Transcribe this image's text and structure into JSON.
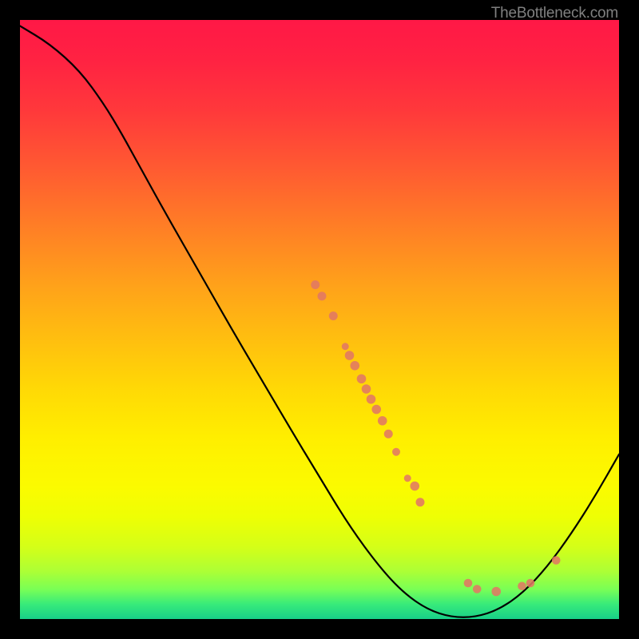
{
  "attribution": "TheBottleneck.com",
  "chart_data": {
    "type": "line",
    "title": "",
    "xlabel": "",
    "ylabel": "",
    "xlim": [
      0,
      100
    ],
    "ylim": [
      0,
      100
    ],
    "gradient_stops": [
      {
        "offset": 0.0,
        "color": "#ff1846"
      },
      {
        "offset": 0.07,
        "color": "#ff2342"
      },
      {
        "offset": 0.15,
        "color": "#ff383b"
      },
      {
        "offset": 0.25,
        "color": "#ff5b31"
      },
      {
        "offset": 0.35,
        "color": "#ff8025"
      },
      {
        "offset": 0.45,
        "color": "#ffa419"
      },
      {
        "offset": 0.55,
        "color": "#ffc40d"
      },
      {
        "offset": 0.62,
        "color": "#ffda05"
      },
      {
        "offset": 0.7,
        "color": "#ffef00"
      },
      {
        "offset": 0.78,
        "color": "#fbfb00"
      },
      {
        "offset": 0.83,
        "color": "#eeff04"
      },
      {
        "offset": 0.88,
        "color": "#d4ff18"
      },
      {
        "offset": 0.92,
        "color": "#adff35"
      },
      {
        "offset": 0.95,
        "color": "#7aff55"
      },
      {
        "offset": 0.975,
        "color": "#38eb7a"
      },
      {
        "offset": 1.0,
        "color": "#18cf88"
      }
    ],
    "curve": [
      {
        "x": 0.0,
        "y": 99.0
      },
      {
        "x": 5.0,
        "y": 96.0
      },
      {
        "x": 10.0,
        "y": 91.5
      },
      {
        "x": 14.0,
        "y": 86.0
      },
      {
        "x": 17.0,
        "y": 81.0
      },
      {
        "x": 20.0,
        "y": 75.5
      },
      {
        "x": 25.0,
        "y": 66.5
      },
      {
        "x": 30.0,
        "y": 57.8
      },
      {
        "x": 35.0,
        "y": 49.0
      },
      {
        "x": 40.0,
        "y": 40.5
      },
      {
        "x": 45.0,
        "y": 32.0
      },
      {
        "x": 50.0,
        "y": 23.7
      },
      {
        "x": 55.0,
        "y": 15.5
      },
      {
        "x": 60.0,
        "y": 8.7
      },
      {
        "x": 64.0,
        "y": 4.4
      },
      {
        "x": 68.0,
        "y": 1.6
      },
      {
        "x": 72.0,
        "y": 0.3
      },
      {
        "x": 76.0,
        "y": 0.3
      },
      {
        "x": 80.0,
        "y": 1.6
      },
      {
        "x": 84.0,
        "y": 4.4
      },
      {
        "x": 88.0,
        "y": 8.7
      },
      {
        "x": 92.0,
        "y": 14.2
      },
      {
        "x": 96.0,
        "y": 20.5
      },
      {
        "x": 100.0,
        "y": 27.5
      }
    ],
    "dots": [
      {
        "x": 49.3,
        "y": 55.8,
        "r": 5.5
      },
      {
        "x": 50.4,
        "y": 53.9,
        "r": 5.5
      },
      {
        "x": 52.3,
        "y": 50.6,
        "r": 5.5
      },
      {
        "x": 54.3,
        "y": 45.5,
        "r": 4.5
      },
      {
        "x": 55.0,
        "y": 44.0,
        "r": 5.8
      },
      {
        "x": 55.9,
        "y": 42.3,
        "r": 5.8
      },
      {
        "x": 57.0,
        "y": 40.1,
        "r": 5.8
      },
      {
        "x": 57.8,
        "y": 38.4,
        "r": 5.8
      },
      {
        "x": 58.6,
        "y": 36.7,
        "r": 5.8
      },
      {
        "x": 59.5,
        "y": 35.0,
        "r": 5.8
      },
      {
        "x": 60.5,
        "y": 33.1,
        "r": 5.8
      },
      {
        "x": 61.5,
        "y": 30.9,
        "r": 5.5
      },
      {
        "x": 62.8,
        "y": 27.9,
        "r": 5.0
      },
      {
        "x": 64.7,
        "y": 23.5,
        "r": 4.5
      },
      {
        "x": 65.9,
        "y": 22.2,
        "r": 5.8
      },
      {
        "x": 66.8,
        "y": 19.5,
        "r": 5.5
      },
      {
        "x": 74.8,
        "y": 6.0,
        "r": 5.3
      },
      {
        "x": 76.3,
        "y": 5.0,
        "r": 5.3
      },
      {
        "x": 79.5,
        "y": 4.6,
        "r": 5.8
      },
      {
        "x": 83.8,
        "y": 5.5,
        "r": 5.3
      },
      {
        "x": 85.2,
        "y": 6.0,
        "r": 5.3
      },
      {
        "x": 89.5,
        "y": 9.8,
        "r": 5.3
      }
    ],
    "dot_color": "#e17864"
  }
}
